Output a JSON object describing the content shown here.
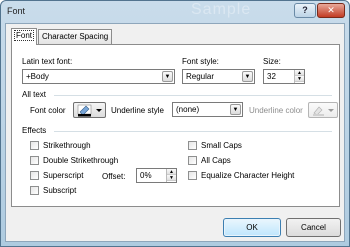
{
  "window": {
    "title": "Font",
    "watermark": "Sample",
    "help_glyph": "?",
    "close_glyph": "✕"
  },
  "tabs": [
    {
      "label": "Font"
    },
    {
      "label": "Character Spacing"
    }
  ],
  "latin_font": {
    "label": "Latin text font:",
    "value": "+Body"
  },
  "font_style": {
    "label": "Font style:",
    "value": "Regular"
  },
  "size": {
    "label": "Size:",
    "value": "32"
  },
  "all_text": {
    "header": "All text",
    "font_color_label": "Font color",
    "underline_style_label": "Underline style",
    "underline_style_value": "(none)",
    "underline_color_label": "Underline color"
  },
  "effects": {
    "header": "Effects",
    "strikethrough": "Strikethrough",
    "double_strikethrough": "Double Strikethrough",
    "superscript": "Superscript",
    "subscript": "Subscript",
    "offset_label": "Offset:",
    "offset_value": "0%",
    "small_caps": "Small Caps",
    "all_caps": "All Caps",
    "equalize": "Equalize Character Height"
  },
  "buttons": {
    "ok": "OK",
    "cancel": "Cancel"
  },
  "colors": {
    "accent_blue": "#3c7fb1",
    "font_color_swatch": "#000000",
    "titlebar": "#c9dceb"
  },
  "icons": {
    "dropdown": "▼",
    "spin_up": "▲",
    "spin_down": "▼"
  }
}
